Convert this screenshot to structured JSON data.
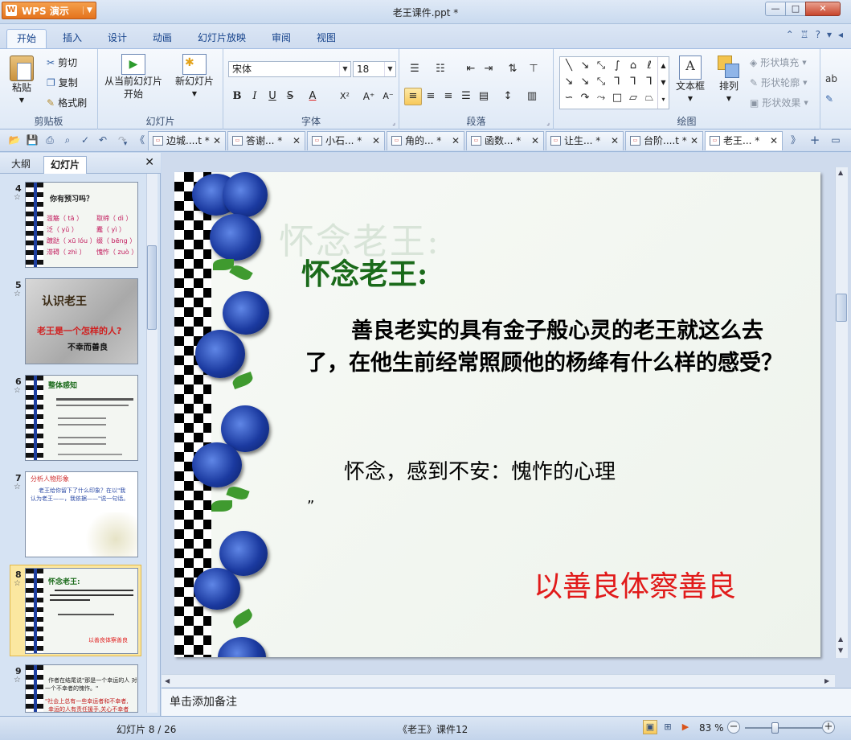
{
  "app": {
    "menu_label": "WPS 演示",
    "logo_letter": "W",
    "doc_title": "老王课件.ppt *"
  },
  "window": {
    "min": "—",
    "max": "□",
    "close": "✕"
  },
  "ribbon_tabs": [
    "开始",
    "插入",
    "设计",
    "动画",
    "幻灯片放映",
    "审阅",
    "视图"
  ],
  "help_icons": {
    "min": "⌃",
    "shirt": "♖",
    "help": "?",
    "arrow": "▾",
    "more": "◂"
  },
  "clipboard": {
    "paste": "粘贴",
    "cut": "剪切",
    "copy": "复制",
    "format_painter": "格式刷",
    "group": "剪贴板"
  },
  "slides_group": {
    "from_current_line1": "从当前幻灯片",
    "from_current_line2": "开始",
    "new_slide": "新幻灯片",
    "group": "幻灯片"
  },
  "font": {
    "name": "宋体",
    "size": "18",
    "group": "字体",
    "bold": "B",
    "italic": "I",
    "underline": "U",
    "strike": "S",
    "color": "A",
    "super": "X²",
    "grow": "A⁺",
    "shrink": "A⁻"
  },
  "paragraph": {
    "group": "段落"
  },
  "drawing": {
    "textbox": "文本框",
    "arrange": "排列",
    "fill": "形状填充",
    "outline": "形状轮廓",
    "effect": "形状效果",
    "group": "绘图"
  },
  "doc_tabs": [
    {
      "label": "边城....t *"
    },
    {
      "label": "答谢... *"
    },
    {
      "label": "小石... *"
    },
    {
      "label": "角的... *"
    },
    {
      "label": "函数... *"
    },
    {
      "label": "让生... *"
    },
    {
      "label": "台阶....t *"
    },
    {
      "label": "老王... *"
    }
  ],
  "left_panel": {
    "tab_outline": "大纲",
    "tab_slides": "幻灯片",
    "close": "✕"
  },
  "thumbnails": [
    {
      "num": "4",
      "star": "☆",
      "lines": [
        "你有预习吗？",
        "滥觞（ tā ）",
        "取缔（ dì ）",
        "泛（ yǔ ）",
        "蠹（ yì ）",
        "踱跶（ xū lóu ）",
        "缀（ bēng ）",
        "滞碍（ zhì ）",
        "愧怍（ zuò ）"
      ]
    },
    {
      "num": "5",
      "star": "☆",
      "lines": [
        "认识老王",
        "老王是一个怎样的人?",
        "不幸而善良"
      ]
    },
    {
      "num": "6",
      "star": "☆",
      "lines": [
        "整体感知"
      ]
    },
    {
      "num": "7",
      "star": "☆",
      "lines": [
        "分析人物形象",
        "老王给你留下了什么印象？在以\"我",
        "认为老王——，我依据——\"说一句话。"
      ]
    },
    {
      "num": "8",
      "star": "☆",
      "lines": [
        "怀念老王:",
        "以善良体察善良"
      ]
    },
    {
      "num": "9",
      "star": "☆",
      "lines": [
        "作者在结尾说\"那是一个幸运的人 对",
        "一个不幸者的愧怍。\"",
        "\"社会上总有一些幸运者和不幸者,",
        "幸运的人有责任援手,关心不幸者"
      ]
    }
  ],
  "slide": {
    "title_shadow": "怀念老王:",
    "title": "怀念老王:",
    "body": "善良老实的具有金子般心灵的老王就这么去了，在他生前经常照顾他的杨绛有什么样的感受？",
    "answer": "怀念，感到不安：愧怍的心理",
    "quote": "”",
    "red_text": "以善良体察善良"
  },
  "notes": {
    "placeholder": "单击添加备注"
  },
  "status": {
    "slide_info": "幻灯片 8 / 26",
    "template": "《老王》课件12",
    "zoom": "83 %",
    "zoom_minus": "−",
    "zoom_plus": "+"
  },
  "colors": {
    "title_green": "#1a6a1a",
    "red_text": "#e11a1a",
    "ribbon_blue": "#15428b"
  }
}
